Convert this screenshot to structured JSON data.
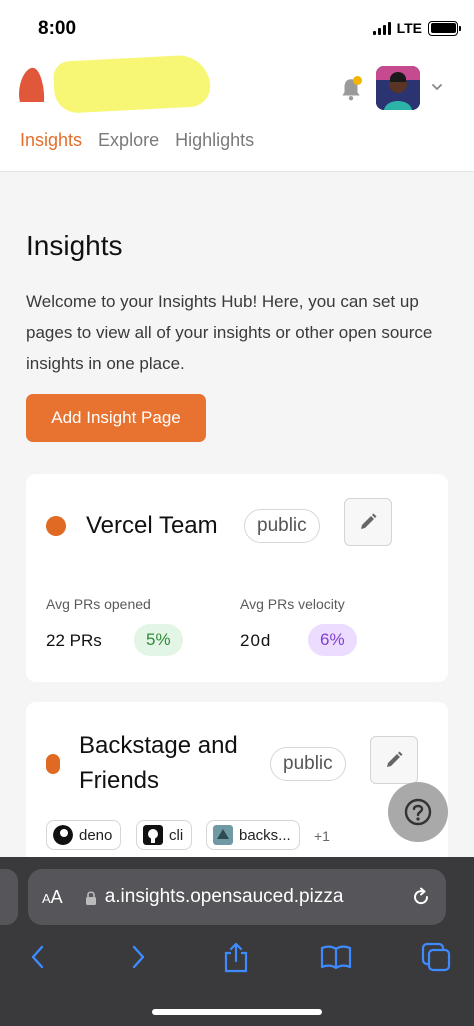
{
  "status": {
    "time": "8:00",
    "network": "LTE"
  },
  "header": {
    "tabs": [
      {
        "label": "Insights",
        "active": true
      },
      {
        "label": "Explore",
        "active": false
      },
      {
        "label": "Highlights",
        "active": false
      }
    ]
  },
  "main": {
    "title": "Insights",
    "description": "Welcome to your Insights Hub! Here, you can set up pages to view all of your insights or other open source insights in one place.",
    "add_button": "Add Insight Page"
  },
  "cards": [
    {
      "name": "Vercel Team",
      "visibility": "public",
      "stats": [
        {
          "label": "Avg PRs opened",
          "value": "22 PRs",
          "badge": "5%"
        },
        {
          "label": "Avg PRs velocity",
          "value": "20d",
          "badge": "6%"
        }
      ]
    },
    {
      "name_line1": "Backstage and",
      "name_line2": "Friends",
      "visibility": "public",
      "repos": [
        "deno",
        "cli",
        "backs..."
      ],
      "more": "+1"
    }
  ],
  "help_label": "?",
  "browser": {
    "aa_small": "A",
    "aa_large": "A",
    "url": "a.insights.opensauced.pizza"
  },
  "colors": {
    "accent": "#e8722f",
    "badge_green": "#e3f5e4",
    "badge_purple": "#ecdcff"
  },
  "icons": [
    "logo-icon",
    "bell-icon",
    "chevron-down-icon",
    "pencil-icon",
    "deno-icon",
    "github-icon",
    "backstage-icon",
    "question-icon",
    "lock-icon",
    "reload-icon",
    "back-icon",
    "forward-icon",
    "share-icon",
    "bookmarks-icon",
    "tabs-icon"
  ]
}
